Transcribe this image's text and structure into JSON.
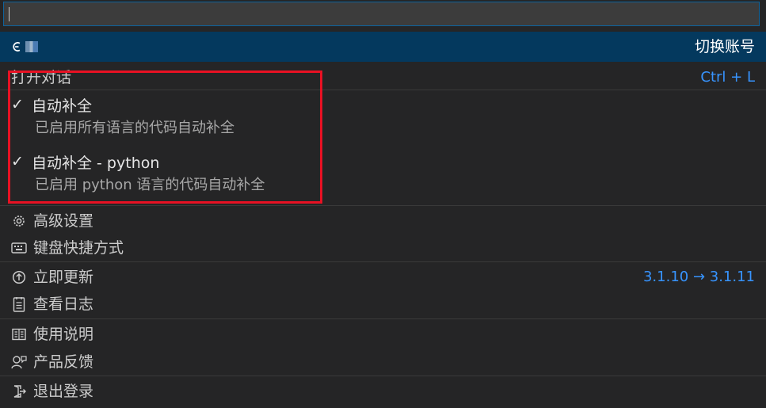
{
  "search": {
    "value": "",
    "placeholder": ""
  },
  "account": {
    "switch_label": "切换账号"
  },
  "open_chat": {
    "label": "打开对话",
    "shortcut": "Ctrl + L"
  },
  "autocomplete": {
    "title": "自动补全",
    "desc": "已启用所有语言的代码自动补全",
    "checked": true
  },
  "autocomplete_python": {
    "title": "自动补全 - python",
    "desc": "已启用 python 语言的代码自动补全",
    "checked": true
  },
  "advanced_settings": {
    "label": "高级设置",
    "icon": "gear-icon"
  },
  "keyboard_shortcuts": {
    "label": "键盘快捷方式",
    "icon": "keyboard-icon"
  },
  "update_now": {
    "label": "立即更新",
    "version": "3.1.10 → 3.1.11",
    "icon": "arrow-up-circle-icon"
  },
  "view_logs": {
    "label": "查看日志",
    "icon": "log-icon"
  },
  "user_guide": {
    "label": "使用说明",
    "icon": "book-icon"
  },
  "feedback": {
    "label": "产品反馈",
    "icon": "feedback-icon"
  },
  "logout": {
    "label": "退出登录",
    "icon": "sign-out-icon"
  },
  "colors": {
    "accent": "#3794ff",
    "selected_row": "#04395e",
    "highlight": "#e81123"
  }
}
